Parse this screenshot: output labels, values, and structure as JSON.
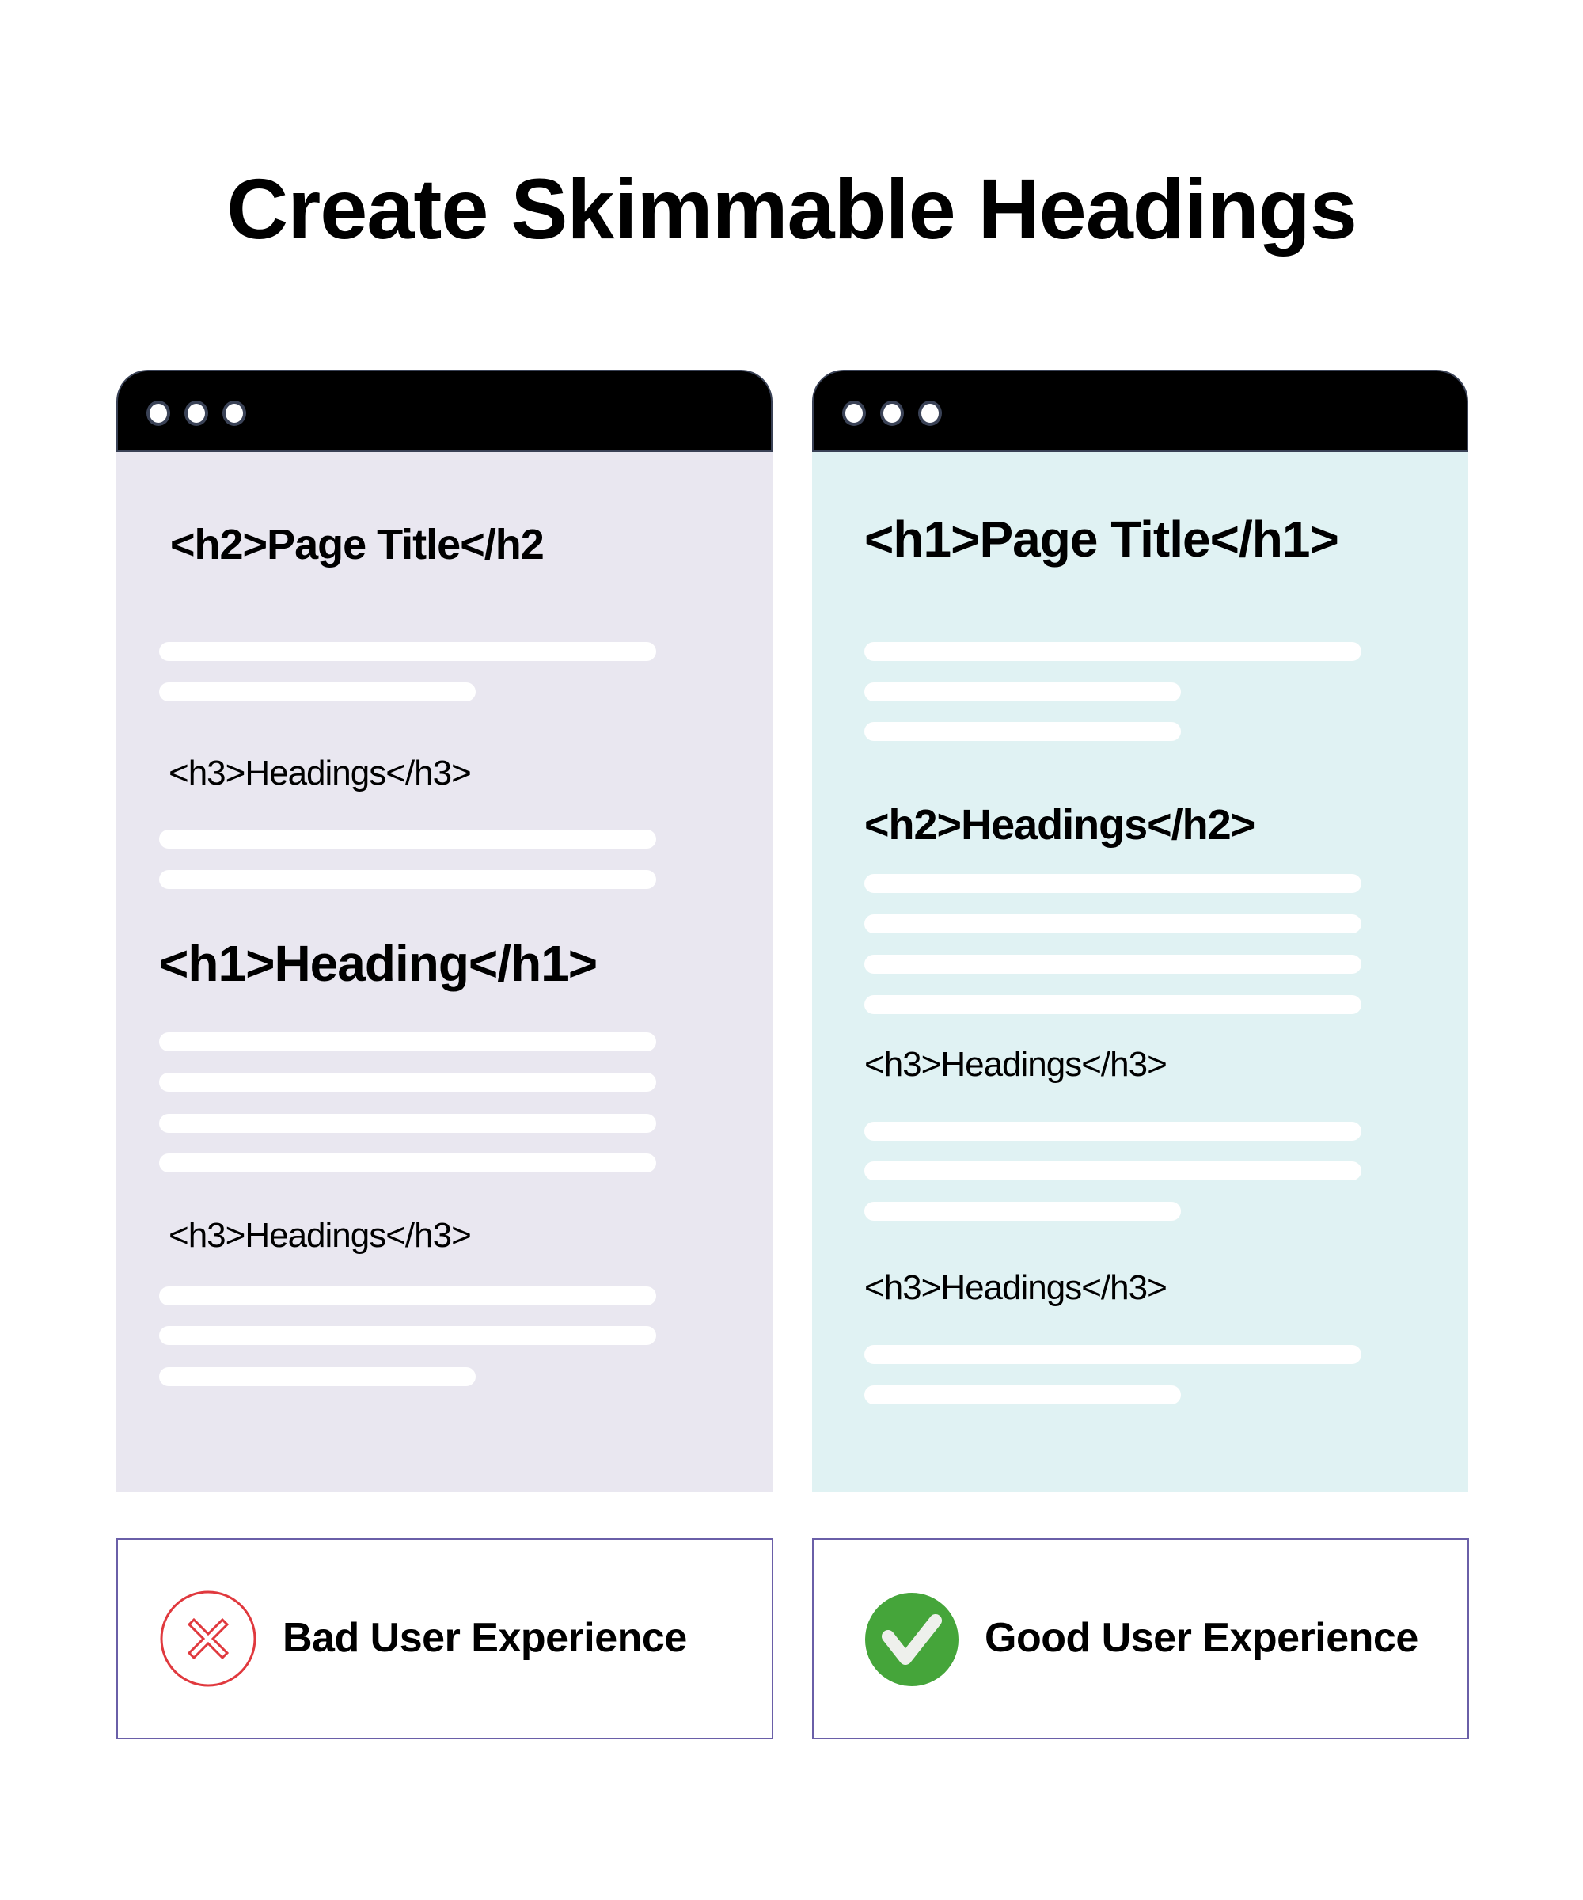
{
  "title": "Create Skimmable Headings",
  "colors": {
    "bad_panel_bg": "#e9e7f0",
    "good_panel_bg": "#e0f2f3",
    "titlebar": "#000000",
    "card_border": "#6a5fa8",
    "bad_icon": "#e0393e",
    "good_icon": "#45a53a"
  },
  "bad_example": {
    "window_dots": 3,
    "page_title": "<h2>Page Title</h2",
    "headings": [
      "<h3>Headings</h3>",
      "<h1>Heading</h1>",
      "<h3>Headings</h3>"
    ],
    "verdict_icon": "x-circle-icon",
    "verdict_label": "Bad User Experience"
  },
  "good_example": {
    "window_dots": 3,
    "page_title": "<h1>Page Title</h1>",
    "headings": [
      "<h2>Headings</h2>",
      "<h3>Headings</h3>",
      "<h3>Headings</h3>"
    ],
    "verdict_icon": "check-circle-icon",
    "verdict_label": "Good User Experience"
  }
}
